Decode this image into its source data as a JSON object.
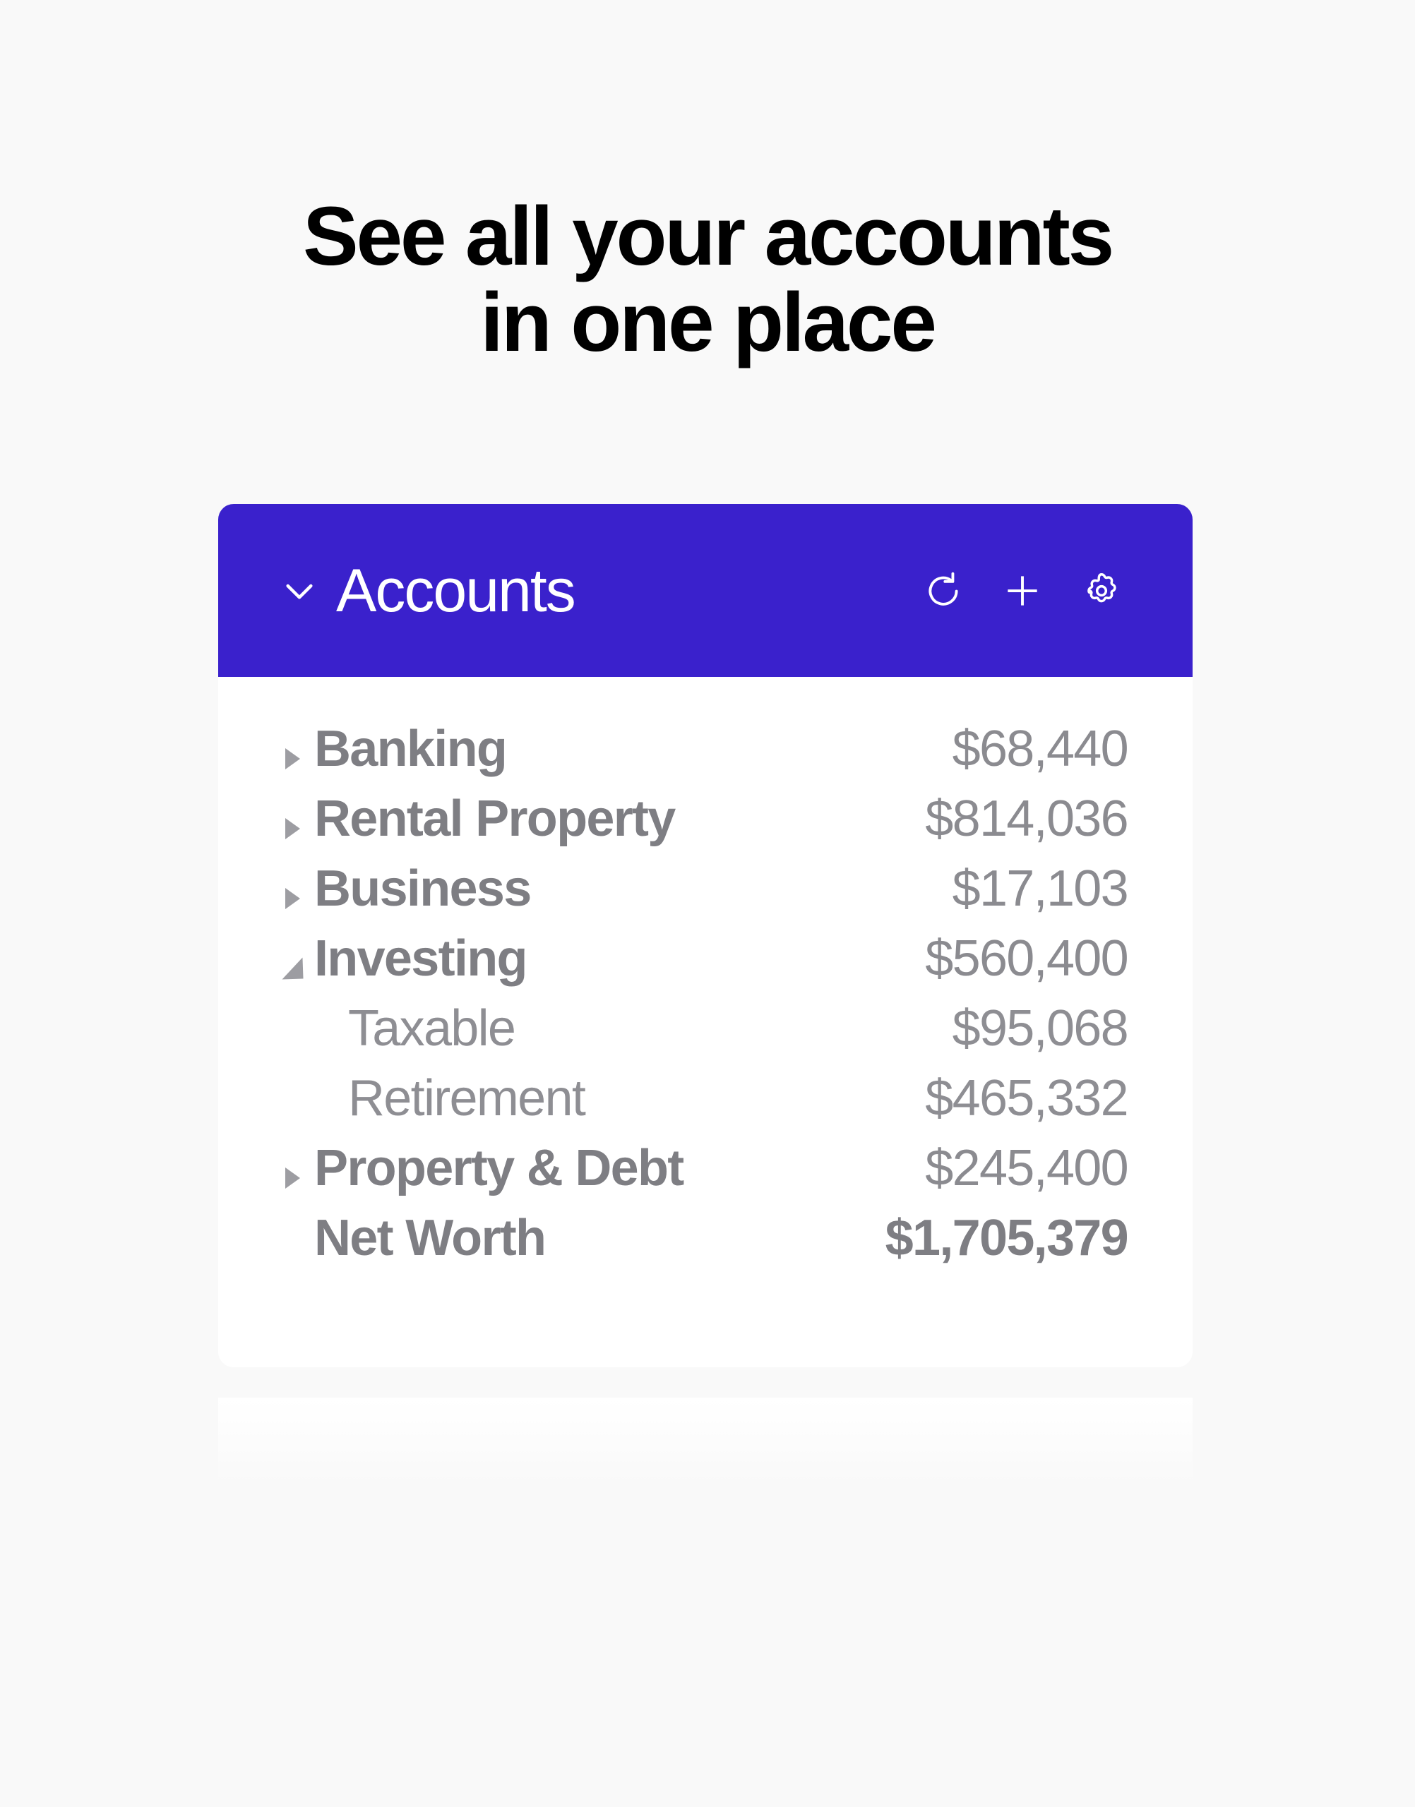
{
  "headline": "See all your accounts\nin one place",
  "theme": {
    "accent": "#3a21cc",
    "page_background": "#f9f9f9",
    "card_background": "#ffffff",
    "label_color": "#7e7e83",
    "value_color": "#8b8b90",
    "sub_row_color": "#8e8e93",
    "marker_color": "#9d9da2",
    "headline_color": "#000000"
  },
  "card": {
    "header": {
      "title": "Accounts",
      "collapse_icon": "chevron-down-icon",
      "actions": [
        {
          "name": "refresh-icon",
          "label": "Refresh"
        },
        {
          "name": "plus-icon",
          "label": "Add account"
        },
        {
          "name": "gear-icon",
          "label": "Settings"
        }
      ]
    },
    "rows": [
      {
        "label": "Banking",
        "value": "$68,440",
        "level": 0,
        "marker": "collapsed"
      },
      {
        "label": "Rental Property",
        "value": "$814,036",
        "level": 0,
        "marker": "collapsed"
      },
      {
        "label": "Business",
        "value": "$17,103",
        "level": 0,
        "marker": "collapsed"
      },
      {
        "label": "Investing",
        "value": "$560,400",
        "level": 0,
        "marker": "expanded"
      },
      {
        "label": "Taxable",
        "value": "$95,068",
        "level": 1,
        "marker": "none"
      },
      {
        "label": "Retirement",
        "value": "$465,332",
        "level": 1,
        "marker": "none"
      },
      {
        "label": "Property & Debt",
        "value": "$245,400",
        "level": 0,
        "marker": "collapsed"
      },
      {
        "label": "Net Worth",
        "value": "$1,705,379",
        "level": 0,
        "marker": "none",
        "total": true
      }
    ]
  }
}
